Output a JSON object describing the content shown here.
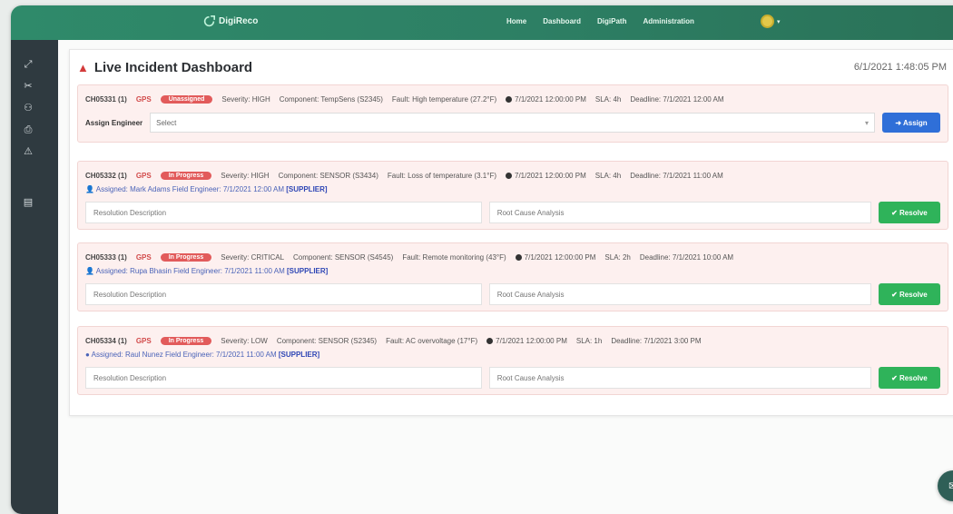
{
  "topbar": {
    "brand": "DigiReco",
    "nav": [
      "Home",
      "Dashboard",
      "DigiPath",
      "Administration"
    ]
  },
  "page": {
    "title": "Live Incident Dashboard",
    "timestamp": "6/1/2021 1:48:05 PM"
  },
  "incidents": [
    {
      "id": "CH05331 (1)",
      "tag": "GPS",
      "badge": "Unassigned",
      "severity": "Severity: HIGH",
      "component": "Component: TempSens (S2345)",
      "fault": "Fault: High temperature (27.2°F)",
      "time": "7/1/2021 12:00:00 PM",
      "sla": "SLA: 4h",
      "deadline": "Deadline: 7/1/2021 12:00 AM",
      "select_label": "Assign Engineer",
      "select_value": "Select",
      "button": "Assign"
    },
    {
      "id": "CH05332 (1)",
      "tag": "GPS",
      "badge": "In Progress",
      "severity": "Severity: HIGH",
      "component": "Component: SENSOR (S3434)",
      "fault": "Fault: Loss of temperature (3.1°F)",
      "time": "7/1/2021 12:00:00 PM",
      "sla": "SLA: 4h",
      "deadline": "Deadline: 7/1/2021 11:00 AM",
      "assignee": "Assigned: Mark Adams",
      "assigned_text": "Field Engineer: 7/1/2021 12:00 AM",
      "assigned_link": "[SUPPLIER]",
      "placeholder1": "Resolution Description",
      "placeholder2": "Root Cause Analysis",
      "button": "Resolve"
    },
    {
      "id": "CH05333 (1)",
      "tag": "GPS",
      "badge": "In Progress",
      "severity": "Severity: CRITICAL",
      "component": "Component: SENSOR (S4545)",
      "fault": "Fault: Remote monitoring (43°F)",
      "time": "7/1/2021 12:00:00 PM",
      "sla": "SLA: 2h",
      "deadline": "Deadline: 7/1/2021 10:00 AM",
      "assignee": "Assigned: Rupa Bhasin",
      "assigned_text": "Field Engineer: 7/1/2021 11:00 AM",
      "assigned_link": "[SUPPLIER]",
      "placeholder1": "Resolution Description",
      "placeholder2": "Root Cause Analysis",
      "button": "Resolve"
    },
    {
      "id": "CH05334 (1)",
      "tag": "GPS",
      "badge": "In Progress",
      "severity": "Severity: LOW",
      "component": "Component: SENSOR (S2345)",
      "fault": "Fault: AC overvoltage (17°F)",
      "time": "7/1/2021 12:00:00 PM",
      "sla": "SLA: 1h",
      "deadline": "Deadline: 7/1/2021 3:00 PM",
      "assignee": "Assigned: Raul Nunez",
      "assigned_text": "Field Engineer: 7/1/2021 11:00 AM",
      "assigned_link": "[SUPPLIER]",
      "placeholder1": "Resolution Description",
      "placeholder2": "Root Cause Analysis",
      "button": "Resolve"
    }
  ],
  "colors": {
    "topbar": "#2f8a6a",
    "sidebar": "#2f3a40",
    "alert": "#e25b5b",
    "primary": "#2f6fd8",
    "success": "#2fb35a"
  }
}
